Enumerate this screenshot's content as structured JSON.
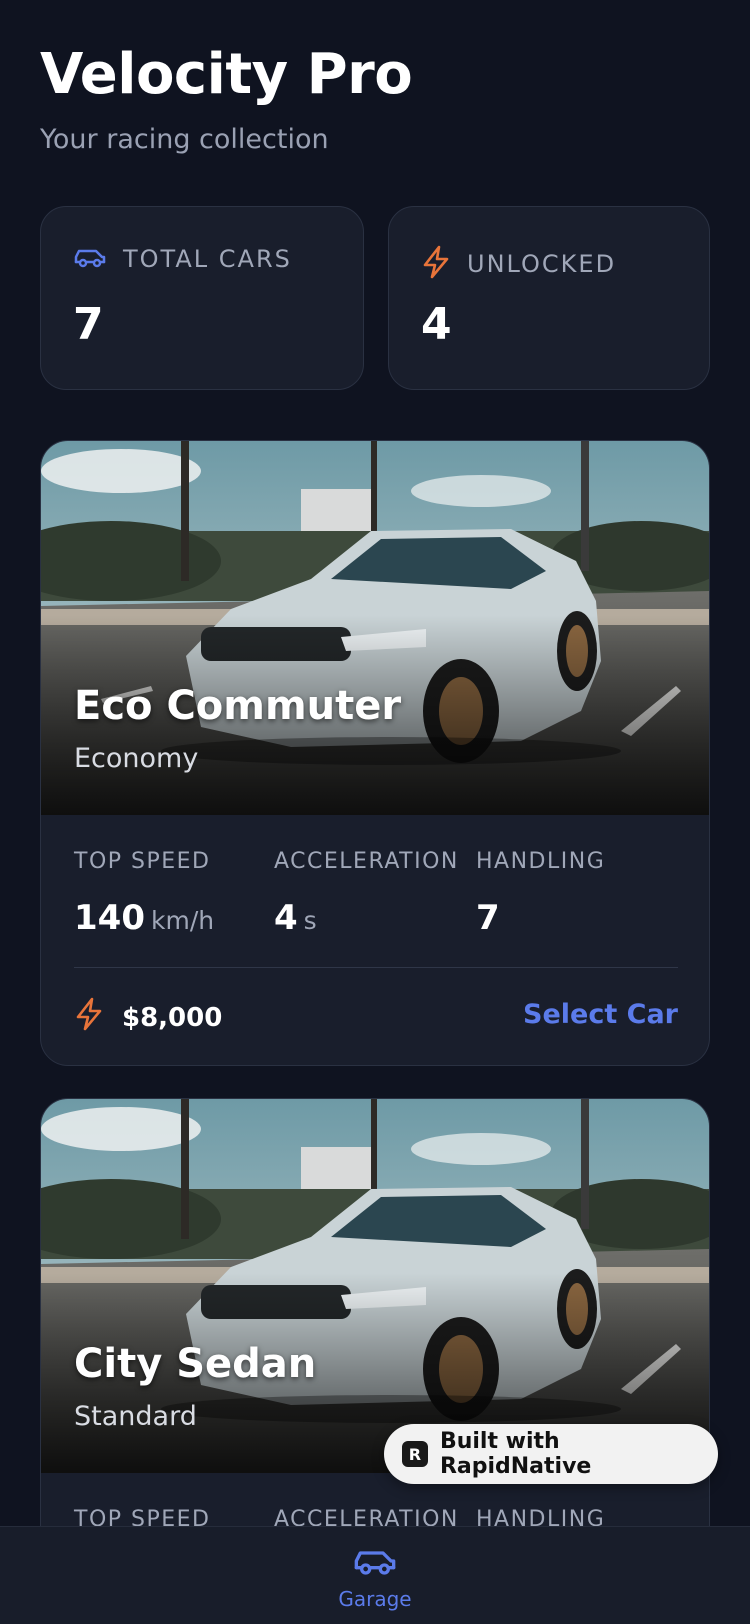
{
  "header": {
    "title": "Velocity Pro",
    "subtitle": "Your racing collection"
  },
  "stats": {
    "total": {
      "icon": "car-icon",
      "label": "TOTAL CARS",
      "value": "7"
    },
    "unlocked": {
      "icon": "bolt-icon",
      "label": "UNLOCKED",
      "value": "4"
    }
  },
  "cars": [
    {
      "name": "Eco Commuter",
      "class": "Economy",
      "stats": [
        {
          "label": "TOP SPEED",
          "value": "140",
          "unit": "km/h"
        },
        {
          "label": "ACCELERATION",
          "value": "4",
          "unit": "s"
        },
        {
          "label": "HANDLING",
          "value": "7",
          "unit": ""
        }
      ],
      "price": "$8,000",
      "action": "Select Car"
    },
    {
      "name": "City Sedan",
      "class": "Standard",
      "stats": [
        {
          "label": "TOP SPEED"
        },
        {
          "label": "ACCELERATION"
        },
        {
          "label": "HANDLING"
        }
      ]
    }
  ],
  "badge": {
    "text": "Built with RapidNative"
  },
  "tabbar": {
    "garage_label": "Garage"
  },
  "colors": {
    "accent": "#5b7bea",
    "orange": "#e8743a",
    "background": "#0f1320",
    "card": "#191e2c"
  }
}
